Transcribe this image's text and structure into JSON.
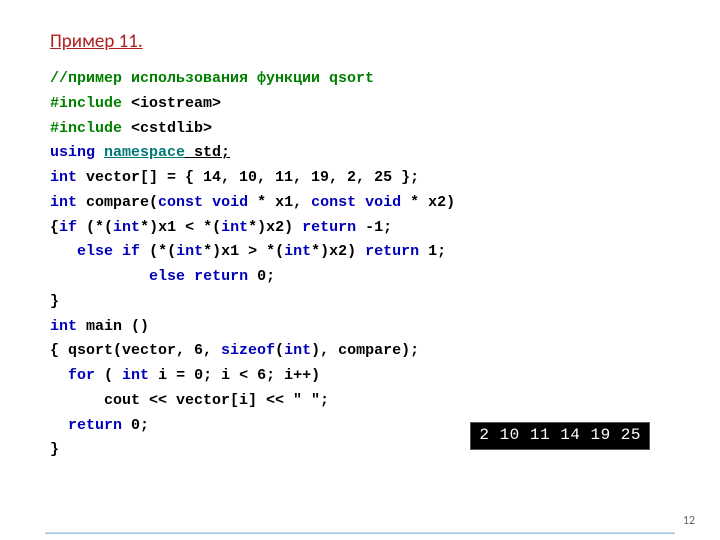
{
  "title": "Пример 11.",
  "code": {
    "l1": {
      "a": "//пример использования функции qsort"
    },
    "l2": {
      "a": "#include ",
      "b": "<iostream>"
    },
    "l3": {
      "a": "#include ",
      "b": "<cstdlib>"
    },
    "l4": {
      "a": "using ",
      "b": "namespace",
      "c": " std;"
    },
    "l5": {
      "a": "int",
      "b": " vector[] = { 14, 10, 11, 19, 2, 25 };"
    },
    "l6": {
      "a": "int",
      "b": " compare(",
      "c": "const",
      "d": " ",
      "e": "void",
      "f": " * x1, ",
      "g": "const",
      "h": " ",
      "i": "void",
      "j": " * x2)"
    },
    "l7": {
      "a": "{",
      "b": "if",
      "c": " (*(",
      "d": "int",
      "e": "*)x1 < *(",
      "f": "int",
      "g": "*)x2) ",
      "h": "return",
      "i": " -1;"
    },
    "l8": {
      "a": "   ",
      "b": "else",
      "c": " ",
      "d": "if",
      "e": " (*(",
      "f": "int",
      "g": "*)x1 > *(",
      "h": "int",
      "i": "*)x2) ",
      "j": "return",
      "k": " 1;"
    },
    "l9": {
      "a": "           ",
      "b": "else",
      "c": " ",
      "d": "return",
      "e": " 0;"
    },
    "l10": {
      "a": "}"
    },
    "l11": {
      "a": "int",
      "b": " main ()"
    },
    "l12": {
      "a": "{ qsort(vector, 6, ",
      "b": "sizeof",
      "c": "(",
      "d": "int",
      "e": "), compare);"
    },
    "l13": {
      "a": "  ",
      "b": "for",
      "c": " ( ",
      "d": "int",
      "e": " i = 0; i < 6; i++)"
    },
    "l14": {
      "a": "      cout << vector[i] << \" \";"
    },
    "l15": {
      "a": "  ",
      "b": "return",
      "c": " 0;"
    },
    "l16": {
      "a": "}"
    }
  },
  "output": "2 10 11 14 19 25",
  "page": "12"
}
